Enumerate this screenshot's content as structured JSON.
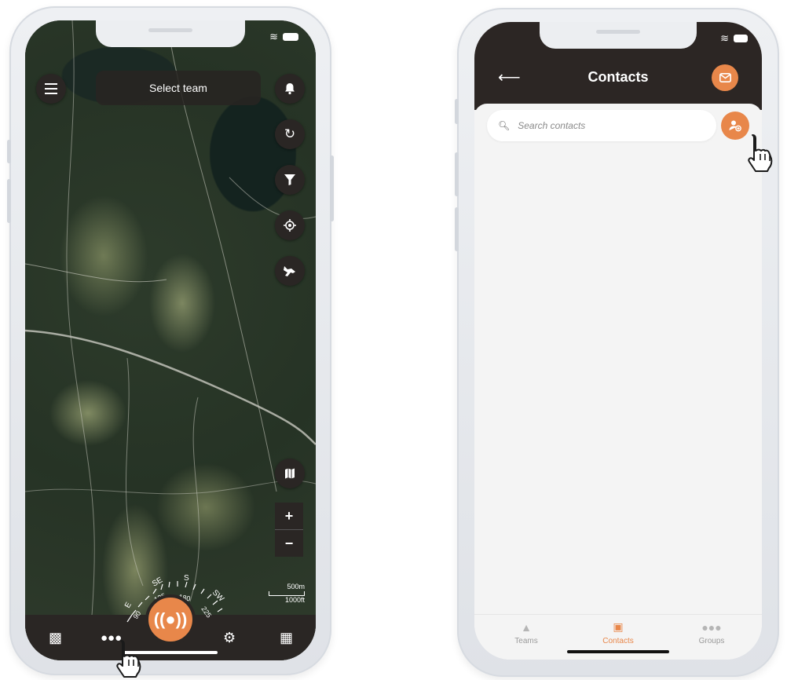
{
  "map_screen": {
    "select_team_label": "Select team",
    "icons": {
      "menu": "hamburger-icon",
      "notifications": "bell-icon",
      "refresh": "refresh-icon",
      "filter": "filter-icon",
      "locate": "crosshair-icon",
      "dog": "dog-icon",
      "map_layers": "map-icon"
    },
    "zoom_in_label": "+",
    "zoom_out_label": "−",
    "scale": {
      "top": "500m",
      "bottom": "1000ft"
    },
    "compass": {
      "labels": [
        "E",
        "SE",
        "S",
        "SW"
      ],
      "degrees": [
        "90",
        "135",
        "180",
        "225"
      ]
    },
    "bottom_nav": [
      "chat-icon",
      "team-icon",
      "alert-icon",
      "settings-icon",
      "calendar-icon"
    ]
  },
  "contacts_screen": {
    "title": "Contacts",
    "search_placeholder": "Search contacts",
    "tabs": [
      {
        "label": "Teams",
        "icon": "teams-icon",
        "active": false
      },
      {
        "label": "Contacts",
        "icon": "contacts-icon",
        "active": true
      },
      {
        "label": "Groups",
        "icon": "groups-icon",
        "active": false
      }
    ]
  },
  "colors": {
    "accent": "#e8874a",
    "dark": "#2c2624",
    "background": "#f4f4f4"
  }
}
